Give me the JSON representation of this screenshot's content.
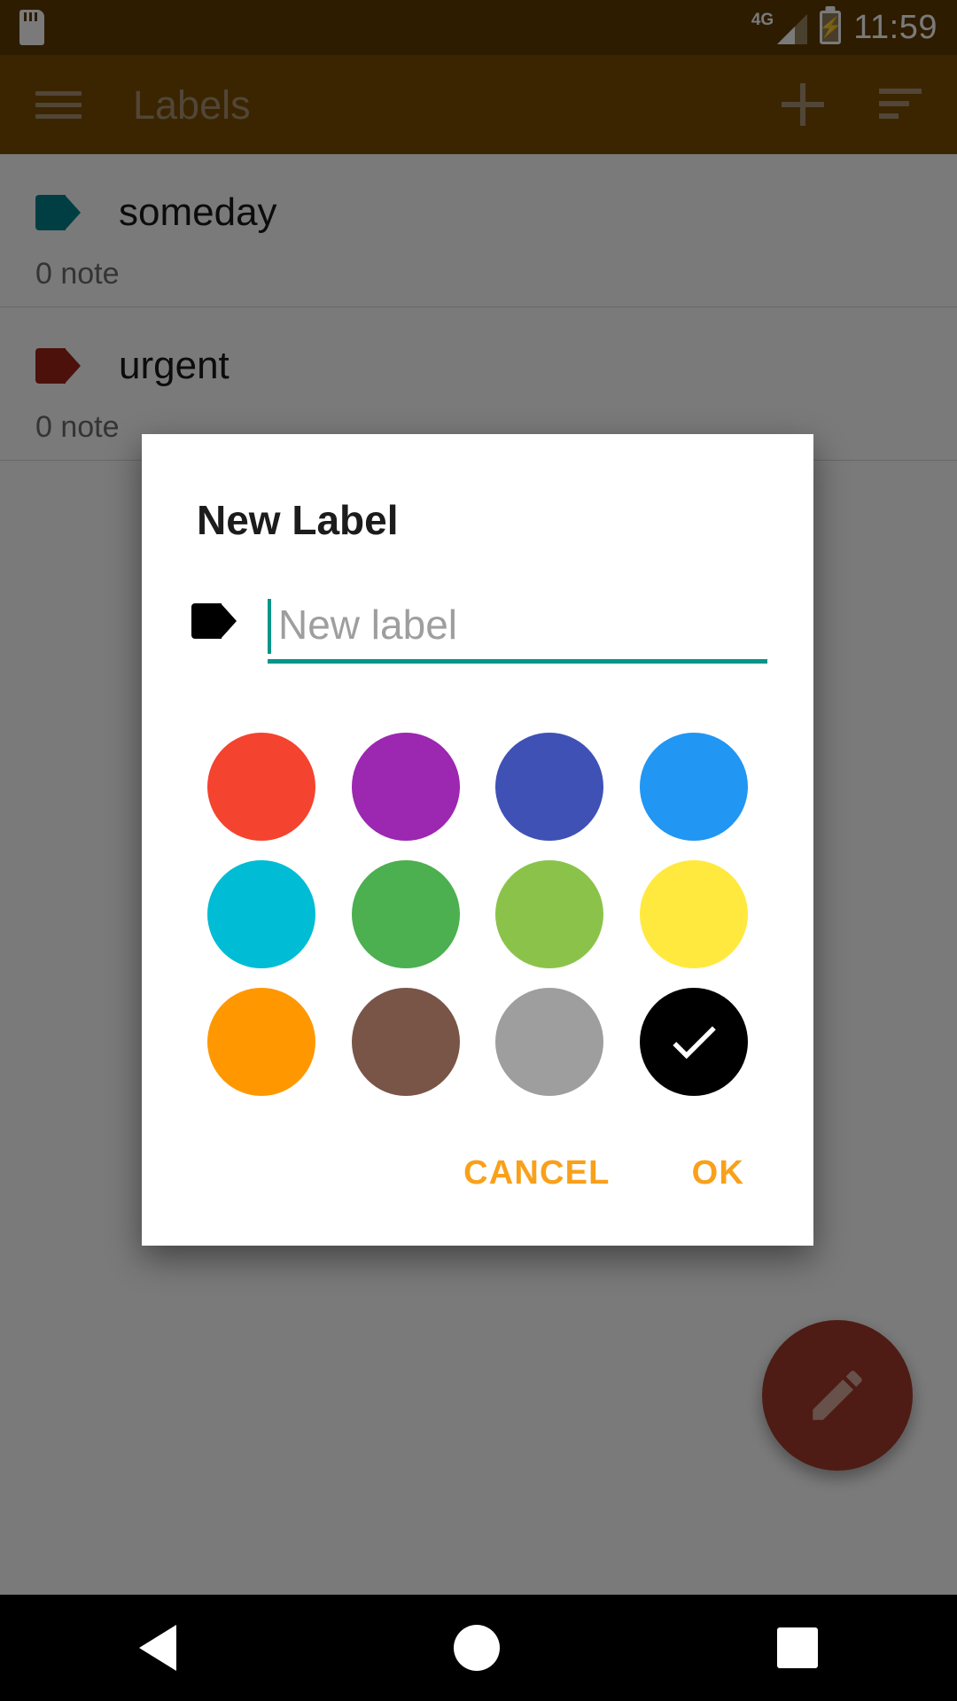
{
  "status_bar": {
    "sd_icon": "sd-card-icon",
    "network_label": "4G",
    "signal_icon": "signal-bars-icon",
    "battery_icon": "battery-charging-icon",
    "battery_bolt": "⚡",
    "clock": "11:59",
    "background": "#5e3c00"
  },
  "app_bar": {
    "menu_icon": "hamburger-menu-icon",
    "title": "Labels",
    "add_icon": "plus-icon",
    "sort_icon": "sort-icon",
    "background": "#7a4e00",
    "foreground": "#a99274"
  },
  "label_list": {
    "rows": [
      {
        "name": "someday",
        "count": "0 note",
        "color": "#00838F"
      },
      {
        "name": "urgent",
        "count": "0 note",
        "color": "#A02418"
      }
    ]
  },
  "fab": {
    "icon": "pencil-icon",
    "color": "#a33b2a"
  },
  "dialog": {
    "title": "New Label",
    "tag_icon": "tag-icon",
    "input": {
      "value": "",
      "placeholder": "New label",
      "underline_color": "#009688",
      "caret_color": "#009688"
    },
    "colors": [
      {
        "name": "red",
        "hex": "#F4432F",
        "selected": false
      },
      {
        "name": "purple",
        "hex": "#9C27B0",
        "selected": false
      },
      {
        "name": "indigo",
        "hex": "#3F51B5",
        "selected": false
      },
      {
        "name": "blue",
        "hex": "#2196F3",
        "selected": false
      },
      {
        "name": "cyan",
        "hex": "#00BCD4",
        "selected": false
      },
      {
        "name": "green",
        "hex": "#4CAF50",
        "selected": false
      },
      {
        "name": "light-green",
        "hex": "#8BC34A",
        "selected": false
      },
      {
        "name": "yellow",
        "hex": "#FFE93F",
        "selected": false
      },
      {
        "name": "orange",
        "hex": "#FF9800",
        "selected": false
      },
      {
        "name": "brown",
        "hex": "#795548",
        "selected": false
      },
      {
        "name": "grey",
        "hex": "#9E9E9E",
        "selected": false
      },
      {
        "name": "black",
        "hex": "#000000",
        "selected": true
      }
    ],
    "cancel_label": "CANCEL",
    "ok_label": "OK",
    "action_color": "#F9A01B"
  },
  "nav_bar": {
    "back_icon": "back-triangle-icon",
    "home_icon": "home-circle-icon",
    "recents_icon": "recents-square-icon"
  }
}
